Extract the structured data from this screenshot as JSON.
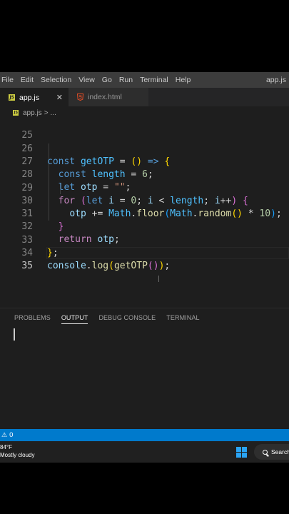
{
  "menubar": {
    "items": [
      "File",
      "Edit",
      "Selection",
      "View",
      "Go",
      "Run",
      "Terminal",
      "Help"
    ],
    "window_title": "app.js"
  },
  "tabs": [
    {
      "label": "app.js",
      "active": true,
      "icon": "js-file-icon",
      "close": "✕"
    },
    {
      "label": "index.html",
      "active": false,
      "icon": "html5-icon"
    }
  ],
  "breadcrumb": {
    "file": "app.js",
    "separator": ">",
    "symbol": "..."
  },
  "editor": {
    "line_numbers": [
      "25",
      "26",
      "27",
      "28",
      "29",
      "30",
      "31",
      "32",
      "33",
      "34",
      "35"
    ],
    "current_line": "35",
    "code": {
      "l26": {
        "kw_const": "const",
        "name": "getOTP",
        "eq": " = ",
        "p1": "(",
        "p2": ")",
        "arrow": " => ",
        "brace": "{"
      },
      "l27": {
        "kw_const": "const",
        "name": "length",
        "eq": " = ",
        "num": "6",
        "semi": ";"
      },
      "l28": {
        "kw_let": "let",
        "name": "otp",
        "eq": " = ",
        "str": "\"\"",
        "semi": ";"
      },
      "l29": {
        "kw_for": "for",
        "p1": "(",
        "kw_let": "let",
        "i": "i",
        "eq": " = ",
        "zero": "0",
        "semi1": "; ",
        "i2": "i",
        "lt": " < ",
        "length": "length",
        "semi2": "; ",
        "i3": "i",
        "inc": "++",
        "p2": ")",
        "brace": "{"
      },
      "l30": {
        "otp": "otp",
        "op": " += ",
        "math": "Math",
        "dot": ".",
        "floor": "floor",
        "p1": "(",
        "math2": "Math",
        "dot2": ".",
        "random": "random",
        "p2": "()",
        "mul": " * ",
        "num": "10",
        "p3": ")",
        "semi": ";"
      },
      "l31": {
        "brace": "}"
      },
      "l32": {
        "kw_return": "return",
        "otp": "otp",
        "semi": ";"
      },
      "l33": {
        "brace": "}",
        "semi": ";"
      },
      "l34": {
        "console": "console",
        "dot": ".",
        "log": "log",
        "p1": "(",
        "fn": "getOTP",
        "p2": "()",
        "p3": ")",
        "semi": ";"
      }
    }
  },
  "panel": {
    "tabs": [
      "PROBLEMS",
      "OUTPUT",
      "DEBUG CONSOLE",
      "TERMINAL"
    ],
    "active_tab": "OUTPUT"
  },
  "statusbar": {
    "warnings": "0"
  },
  "taskbar": {
    "temperature": "84°F",
    "weather": "Mostly cloudy",
    "search_label": "Search"
  },
  "colors": {
    "keyword": "#569cd6",
    "control": "#c586c0",
    "variable": "#9cdcfe",
    "constant": "#4fc1ff",
    "function": "#dcdcaa",
    "number": "#b5cea8",
    "string": "#ce9178",
    "statusbar": "#007acc"
  }
}
